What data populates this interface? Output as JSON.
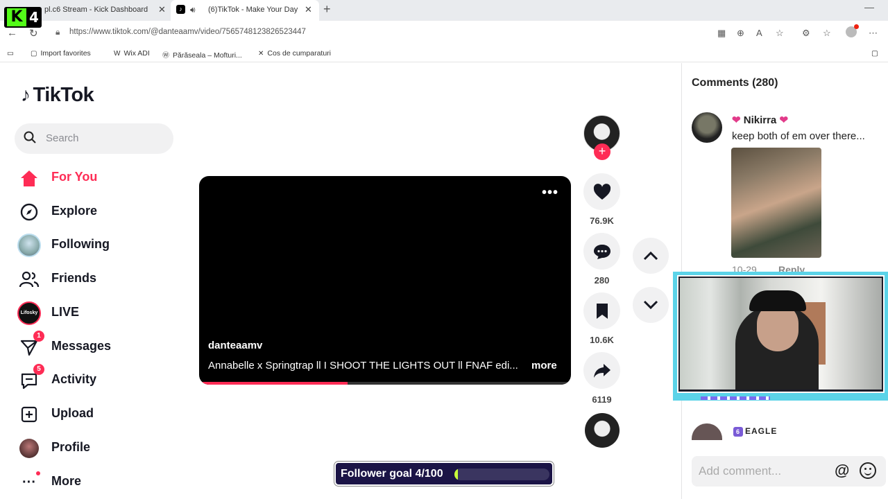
{
  "browser": {
    "tabs": [
      {
        "title": "pl.c6 Stream - Kick Dashboard"
      },
      {
        "title": "(6)TikTok - Make Your Day"
      }
    ],
    "url": "https://www.tiktok.com/@danteaamv/video/7565748123826523447",
    "overlay_logo_number": "4",
    "favorites": [
      {
        "label": "Import favorites"
      },
      {
        "label": "Wix ADI"
      },
      {
        "label": "Părăseala – Mofturi..."
      },
      {
        "label": "Cos de cumparaturi"
      }
    ]
  },
  "sidebar": {
    "logo": "TikTok",
    "search_placeholder": "Search",
    "items": [
      {
        "label": "For You",
        "icon": "home-icon",
        "active": true
      },
      {
        "label": "Explore",
        "icon": "compass-icon"
      },
      {
        "label": "Following",
        "icon": "following-avatar"
      },
      {
        "label": "Friends",
        "icon": "friends-icon"
      },
      {
        "label": "LIVE",
        "icon": "live-avatar",
        "avatar_text": "Lifosky"
      },
      {
        "label": "Messages",
        "icon": "messages-icon",
        "badge": "1"
      },
      {
        "label": "Activity",
        "icon": "activity-icon",
        "badge": "5"
      },
      {
        "label": "Upload",
        "icon": "upload-icon"
      },
      {
        "label": "Profile",
        "icon": "profile-avatar"
      },
      {
        "label": "More",
        "icon": "more-icon"
      }
    ]
  },
  "video": {
    "author": "danteaamv",
    "description": "Annabelle x Springtrap ll I SHOOT THE LIGHTS OUT ll FNAF edi...",
    "more_label": "more",
    "progress": 0.4
  },
  "actions": {
    "likes": "76.9K",
    "comments": "280",
    "saves": "10.6K",
    "shares": "6119"
  },
  "follower_goal": {
    "text": "Follower goal 4/100",
    "current": 4,
    "target": 100
  },
  "comments": {
    "title": "Comments (280)",
    "items": [
      {
        "name": "Nikirra",
        "text": "keep both of em over there...",
        "date": "10-29",
        "reply_label": "Reply"
      },
      {
        "name": "EAGLE"
      }
    ],
    "input_placeholder": "Add comment..."
  },
  "colors": {
    "accent": "#fe2c55",
    "goal_bg": "#1b1446",
    "goal_fill": "#c8ff3a",
    "webcam_border": "#5bd3e8"
  }
}
